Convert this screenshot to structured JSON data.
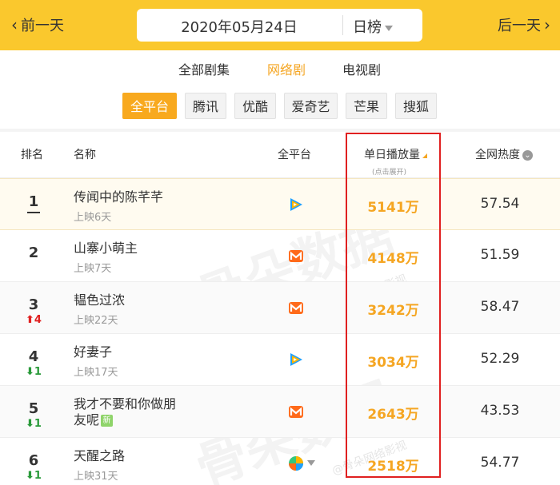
{
  "nav": {
    "prev_label": "前一天",
    "next_label": "后一天",
    "date": "2020年05月24日",
    "rank_type": "日榜"
  },
  "tabs": [
    {
      "label": "全部剧集",
      "active": false
    },
    {
      "label": "网络剧",
      "active": true
    },
    {
      "label": "电视剧",
      "active": false
    }
  ],
  "platforms": [
    {
      "label": "全平台",
      "active": true
    },
    {
      "label": "腾讯",
      "active": false
    },
    {
      "label": "优酷",
      "active": false
    },
    {
      "label": "爱奇艺",
      "active": false
    },
    {
      "label": "芒果",
      "active": false
    },
    {
      "label": "搜狐",
      "active": false
    }
  ],
  "table": {
    "headers": {
      "rank": "排名",
      "name": "名称",
      "platform": "全平台",
      "views": "单日播放量",
      "views_hint": "(点击展开)",
      "heat": "全网热度"
    },
    "rows": [
      {
        "rank": "1",
        "change": "",
        "change_dir": "",
        "title": "传闻中的陈芊芊",
        "sub": "上映6天",
        "platform_icon": "tencent-video-icon",
        "views": "5141万",
        "heat": "57.54"
      },
      {
        "rank": "2",
        "change": "",
        "change_dir": "",
        "title": "山寨小萌主",
        "sub": "上映7天",
        "platform_icon": "mango-tv-icon",
        "views": "4148万",
        "heat": "51.59"
      },
      {
        "rank": "3",
        "change": "4",
        "change_dir": "up",
        "title": "韫色过浓",
        "sub": "上映22天",
        "platform_icon": "mango-tv-icon",
        "views": "3242万",
        "heat": "58.47"
      },
      {
        "rank": "4",
        "change": "1",
        "change_dir": "down",
        "title": "好妻子",
        "sub": "上映17天",
        "platform_icon": "tencent-video-icon",
        "views": "3034万",
        "heat": "52.29"
      },
      {
        "rank": "5",
        "change": "1",
        "change_dir": "down",
        "title": "我才不要和你做朋友呢",
        "sub": "",
        "badge": "新",
        "platform_icon": "mango-tv-icon",
        "views": "2643万",
        "heat": "43.53"
      },
      {
        "rank": "6",
        "change": "1",
        "change_dir": "down",
        "title": "天醒之路",
        "sub": "上映31天",
        "platform_icon": "multi-platform-icon",
        "views": "2518万",
        "heat": "54.77"
      }
    ]
  },
  "watermark": {
    "brand": "骨朵数据",
    "sub": "@骨朵网络影视"
  },
  "colors": {
    "brand_yellow": "#fac82d",
    "accent_orange": "#f5a623",
    "highlight_red": "#e02020",
    "rise_red": "#e02020",
    "fall_green": "#2a9a3a"
  }
}
